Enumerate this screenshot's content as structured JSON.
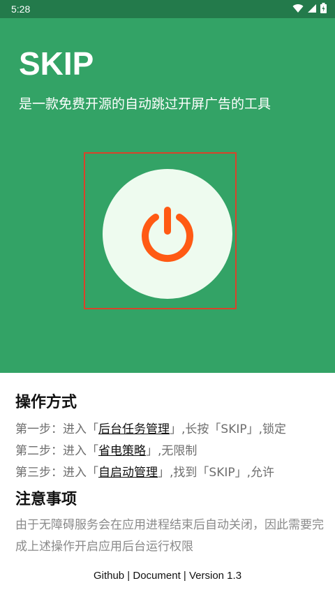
{
  "status_bar": {
    "time": "5:28",
    "icons": [
      "wifi-icon",
      "signal-icon",
      "battery-icon"
    ]
  },
  "app": {
    "title": "SKIP",
    "subtitle": "是一款免费开源的自动跳过开屏广告的工具"
  },
  "power_button": {
    "icon": "power-icon",
    "color": "#ff5a14",
    "frame_color": "#d9432a"
  },
  "colors": {
    "hero_bg": "#33a366",
    "status_bar_bg": "#237a4b",
    "button_bg": "#eefbef"
  },
  "usage": {
    "title": "操作方式",
    "steps": [
      {
        "prefix": "第一步：进入「",
        "link": "后台任务管理",
        "suffix": "」,长按「SKIP」,锁定"
      },
      {
        "prefix": "第二步：进入「",
        "link": "省电策略",
        "suffix": "」,无限制"
      },
      {
        "prefix": "第三步：进入「",
        "link": "自启动管理",
        "suffix": "」,找到「SKIP」,允许"
      }
    ]
  },
  "notes": {
    "title": "注意事项",
    "text": "由于无障碍服务会在应用进程结束后自动关闭，因此需要完成上述操作开启应用后台运行权限"
  },
  "footer": {
    "github": "Github",
    "document": "Document",
    "version": "Version 1.3",
    "separator": " | "
  }
}
